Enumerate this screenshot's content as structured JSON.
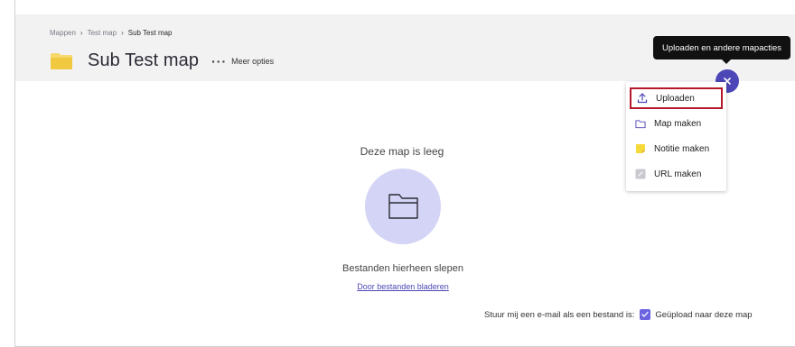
{
  "breadcrumb": {
    "items": [
      "Mappen",
      "Test map",
      "Sub Test map"
    ]
  },
  "header": {
    "title": "Sub Test map",
    "more_options_label": "Meer opties"
  },
  "tooltip": {
    "text": "Uploaden en andere mapacties"
  },
  "menu": {
    "items": [
      {
        "label": "Uploaden",
        "icon": "upload-icon"
      },
      {
        "label": "Map maken",
        "icon": "folder-icon"
      },
      {
        "label": "Notitie maken",
        "icon": "note-icon"
      },
      {
        "label": "URL maken",
        "icon": "link-icon"
      }
    ]
  },
  "empty_state": {
    "title": "Deze map is leeg",
    "drop_text": "Bestanden hierheen slepen",
    "browse_link": "Door bestanden bladeren"
  },
  "notify": {
    "prefix": "Stuur mij een e-mail als een bestand is:",
    "option_label": "Geüpload naar deze map",
    "checked": true
  },
  "colors": {
    "accent": "#4c46b6",
    "highlight_border": "#b5182b",
    "folder_yellow": "#f6d86b",
    "empty_circle": "#d4d4f6",
    "checkbox": "#6c63e0"
  }
}
